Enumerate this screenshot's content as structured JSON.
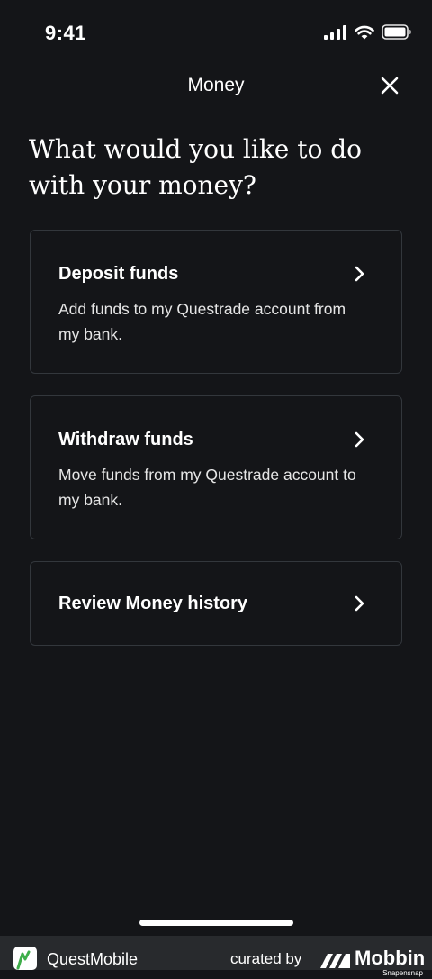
{
  "status_bar": {
    "time": "9:41",
    "icons": [
      "cellular-signal-icon",
      "wifi-icon",
      "battery-icon"
    ]
  },
  "nav": {
    "title": "Money",
    "close_icon": "close-icon"
  },
  "heading": "What would you like to do with your money?",
  "options": [
    {
      "title": "Deposit funds",
      "description": "Add funds to my Questrade account from my bank.",
      "icon": "chevron-right-icon"
    },
    {
      "title": "Withdraw funds",
      "description": "Move funds from my Questrade account to my bank.",
      "icon": "chevron-right-icon"
    },
    {
      "title": "Review Money history",
      "description": "",
      "icon": "chevron-right-icon"
    }
  ],
  "footer": {
    "app_name": "QuestMobile",
    "curated_by": "curated by",
    "brand": "Mobbin",
    "watermark": "Snapensnap"
  },
  "colors": {
    "background": "#141518",
    "card_border": "#33373c",
    "text": "#ffffff",
    "footer_bg": "#282a2d",
    "app_logo_accent": "#3fae4a"
  }
}
